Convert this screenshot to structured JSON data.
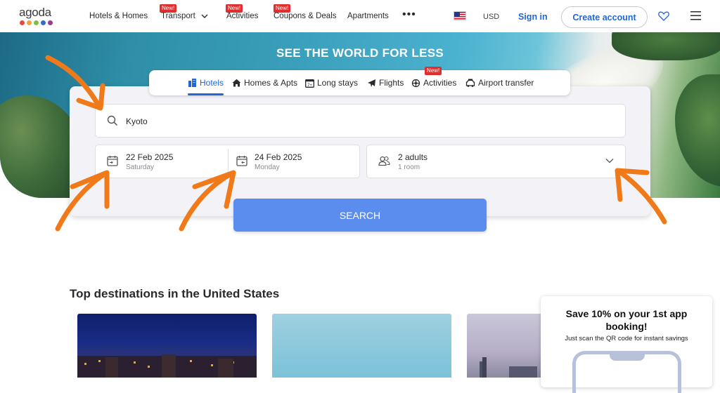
{
  "header": {
    "logo_text": "agoda",
    "logo_dot_colors": [
      "#e8483d",
      "#f2a23b",
      "#7ac043",
      "#2f71c7",
      "#9b3d93"
    ],
    "nav": [
      {
        "label": "Hotels & Homes",
        "badge": ""
      },
      {
        "label": "Transport",
        "badge": "New!"
      },
      {
        "label": "Activities",
        "badge": "New!"
      },
      {
        "label": "Coupons & Deals",
        "badge": "New!"
      },
      {
        "label": "Apartments",
        "badge": ""
      }
    ],
    "more": "•••",
    "currency": "USD",
    "sign_in": "Sign in",
    "create_account": "Create account"
  },
  "hero": {
    "title": "SEE THE WORLD FOR LESS"
  },
  "tabs": [
    {
      "label": "Hotels",
      "icon": "hotel-icon",
      "active": true
    },
    {
      "label": "Homes & Apts",
      "icon": "home-icon"
    },
    {
      "label": "Long stays",
      "icon": "calendar-icon"
    },
    {
      "label": "Flights",
      "icon": "plane-icon"
    },
    {
      "label": "Activities",
      "icon": "activities-icon",
      "badge": "New!"
    },
    {
      "label": "Airport transfer",
      "icon": "car-icon"
    }
  ],
  "search": {
    "destination": "Kyoto",
    "check_in": {
      "date": "22 Feb 2025",
      "day": "Saturday"
    },
    "check_out": {
      "date": "24 Feb 2025",
      "day": "Monday"
    },
    "occupancy": {
      "guests": "2 adults",
      "rooms": "1 room"
    },
    "button": "SEARCH"
  },
  "annotation_color": "#f07a1a",
  "destinations": {
    "title": "Top destinations in the United States"
  },
  "promo": {
    "title": "Save 10% on your 1st app booking!",
    "subtitle": "Just scan the QR code for instant savings"
  }
}
